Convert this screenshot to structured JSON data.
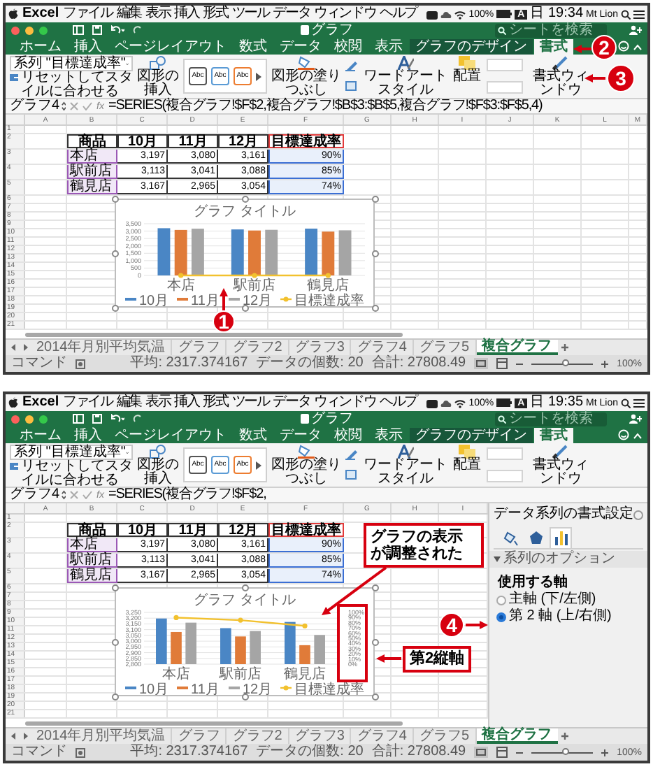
{
  "screens": [
    {
      "menu_bar": {
        "items": [
          "Excel",
          "ファイル",
          "編集",
          "表示",
          "挿入",
          "形式",
          "ツール",
          "データ",
          "ウィンドウ",
          "ヘルプ"
        ],
        "battery": "100%",
        "input_source": "A",
        "clock": "日 19:34",
        "user": "Mt Lion"
      },
      "title_bar": {
        "title": "グラフ",
        "search_placeholder": "シートを検索"
      },
      "ribbon_tabs": [
        {
          "label": "ホーム",
          "selected": false,
          "contextual": false
        },
        {
          "label": "挿入",
          "selected": false,
          "contextual": false
        },
        {
          "label": "ページレイアウト",
          "selected": false,
          "contextual": false
        },
        {
          "label": "数式",
          "selected": false,
          "contextual": false
        },
        {
          "label": "データ",
          "selected": false,
          "contextual": false
        },
        {
          "label": "校閲",
          "selected": false,
          "contextual": false
        },
        {
          "label": "表示",
          "selected": false,
          "contextual": false
        },
        {
          "label": "グラフのデザイン",
          "selected": false,
          "contextual": true
        },
        {
          "label": "書式",
          "selected": true,
          "contextual": true
        }
      ],
      "ribbon": {
        "series_selector": "系列 \"目標達成率\"",
        "reset_button": "リセットしてスタイルに合わせる",
        "insert_shape": "図形の挿入",
        "style_samples": [
          {
            "label": "Abc",
            "color": "#555555"
          },
          {
            "label": "Abc",
            "color": "#5b9bd5"
          },
          {
            "label": "Abc",
            "color": "#ed7d31"
          }
        ],
        "shape_fill": "図形の塗りつぶし",
        "wordart": "ワードアートスタイル",
        "arrange": "配置",
        "format_pane": "書式ウィンドウ"
      },
      "formula_bar": {
        "name_box": "グラフ4",
        "function_button": "fx",
        "formula": "=SERIES(複合グラフ!$F$2,複合グラフ!$B$3:$B$5,複合グラフ!$F$3:$F$5,4)"
      },
      "columns": [
        "A",
        "B",
        "C",
        "D",
        "E",
        "F",
        "G",
        "H",
        "I",
        "J",
        "K",
        "L",
        "M"
      ],
      "row_numbers": [
        "1",
        "2",
        "3",
        "4",
        "5",
        "6",
        "7",
        "8",
        "9",
        "10",
        "11",
        "12",
        "13",
        "14",
        "15",
        "16",
        "17",
        "18",
        "19",
        "20",
        "21"
      ],
      "table": {
        "header": [
          "商品",
          "10月",
          "11月",
          "12月",
          "目標達成率"
        ],
        "rows": [
          [
            "本店",
            "3,197",
            "3,080",
            "3,161",
            "90%"
          ],
          [
            "駅前店",
            "3,113",
            "3,041",
            "3,088",
            "85%"
          ],
          [
            "鶴見店",
            "3,167",
            "2,965",
            "3,054",
            "74%"
          ]
        ]
      },
      "chart": {
        "selected": true,
        "chart_data": {
          "type": "bar",
          "title": "グラフ タイトル",
          "categories": [
            "本店",
            "駅前店",
            "鶴見店"
          ],
          "series": [
            {
              "name": "10月",
              "color": "#4a86c5",
              "values": [
                3197,
                3113,
                3167
              ]
            },
            {
              "name": "11月",
              "color": "#e07b39",
              "values": [
                3080,
                3041,
                2965
              ]
            },
            {
              "name": "12月",
              "color": "#a5a5a5",
              "values": [
                3161,
                3088,
                3054
              ]
            },
            {
              "name": "目標達成率",
              "type": "line",
              "marker": "circle",
              "color": "#f2c12e",
              "values": [
                0.9,
                0.85,
                0.74
              ]
            }
          ],
          "ylim": [
            0,
            3500
          ],
          "yticks": [
            {
              "value": 0,
              "label": "0"
            },
            {
              "value": 500,
              "label": "500"
            },
            {
              "value": 1000,
              "label": "1,000"
            },
            {
              "value": 1500,
              "label": "1,500"
            },
            {
              "value": 2000,
              "label": "2,000"
            },
            {
              "value": 2500,
              "label": "2,500"
            },
            {
              "value": 3000,
              "label": "3,000"
            },
            {
              "value": 3500,
              "label": "3,500"
            }
          ],
          "grid": true,
          "legend": true
        }
      },
      "sheet_tabs": [
        {
          "label": "2014年月別平均気温",
          "selected": false
        },
        {
          "label": "グラフ",
          "selected": false
        },
        {
          "label": "グラフ2",
          "selected": false
        },
        {
          "label": "グラフ3",
          "selected": false
        },
        {
          "label": "グラフ4",
          "selected": false
        },
        {
          "label": "グラフ5",
          "selected": false
        },
        {
          "label": "複合グラフ",
          "selected": true
        }
      ],
      "status_bar": {
        "mode": "コマンド",
        "average": "平均: 2317.374167",
        "count": "データの個数: 20",
        "sum": "合計: 27808.49",
        "zoom": "100%",
        "zoom_slider": {
          "level": 0.55
        }
      },
      "callouts": [
        {
          "kind": "badge",
          "text": "2"
        },
        {
          "kind": "badge",
          "text": "3"
        },
        {
          "kind": "badge",
          "text": "1"
        }
      ]
    },
    {
      "menu_bar": {
        "items": [
          "Excel",
          "ファイル",
          "編集",
          "表示",
          "挿入",
          "形式",
          "ツール",
          "データ",
          "ウィンドウ",
          "ヘルプ"
        ],
        "battery": "100%",
        "input_source": "A",
        "clock": "日 19:35",
        "user": "Mt Lion"
      },
      "title_bar": {
        "title": "グラフ",
        "search_placeholder": "シートを検索"
      },
      "ribbon_tabs": [
        {
          "label": "ホーム",
          "selected": false,
          "contextual": false
        },
        {
          "label": "挿入",
          "selected": false,
          "contextual": false
        },
        {
          "label": "ページレイアウト",
          "selected": false,
          "contextual": false
        },
        {
          "label": "数式",
          "selected": false,
          "contextual": false
        },
        {
          "label": "データ",
          "selected": false,
          "contextual": false
        },
        {
          "label": "校閲",
          "selected": false,
          "contextual": false
        },
        {
          "label": "表示",
          "selected": false,
          "contextual": false
        },
        {
          "label": "グラフのデザイン",
          "selected": false,
          "contextual": true
        },
        {
          "label": "書式",
          "selected": true,
          "contextual": true
        }
      ],
      "ribbon": {
        "series_selector": "系列 \"目標達成率\"",
        "reset_button": "リセットしてスタイルに合わせる",
        "insert_shape": "図形の挿入",
        "style_samples": [
          {
            "label": "Abc",
            "color": "#555555"
          },
          {
            "label": "Abc",
            "color": "#5b9bd5"
          },
          {
            "label": "Abc",
            "color": "#ed7d31"
          }
        ],
        "shape_fill": "図形の塗りつぶし",
        "wordart": "ワードアートスタイル",
        "arrange": "配置",
        "format_pane": "書式ウィンドウ"
      },
      "formula_bar": {
        "name_box": "グラフ4",
        "function_button": "fx",
        "formula": "=SERIES(複合グラフ!$F$2,"
      },
      "columns": [
        "A",
        "B",
        "C",
        "D",
        "E",
        "F",
        "G",
        "H",
        "I"
      ],
      "row_numbers": [
        "1",
        "2",
        "3",
        "4",
        "5",
        "6",
        "7",
        "8",
        "9",
        "10",
        "11",
        "12",
        "13",
        "14",
        "15",
        "16",
        "17",
        "18",
        "19",
        "20",
        "21"
      ],
      "table": {
        "header": [
          "商品",
          "10月",
          "11月",
          "12月",
          "目標達成率"
        ],
        "rows": [
          [
            "本店",
            "3,197",
            "3,080",
            "3,161",
            "90%"
          ],
          [
            "駅前店",
            "3,113",
            "3,041",
            "3,088",
            "85%"
          ],
          [
            "鶴見店",
            "3,167",
            "2,965",
            "3,054",
            "74%"
          ]
        ]
      },
      "chart": {
        "selected": true,
        "chart_data": {
          "type": "bar",
          "title": "グラフ タイトル",
          "categories": [
            "本店",
            "駅前店",
            "鶴見店"
          ],
          "series": [
            {
              "name": "10月",
              "color": "#4a86c5",
              "values": [
                3197,
                3113,
                3167
              ]
            },
            {
              "name": "11月",
              "color": "#e07b39",
              "values": [
                3080,
                3041,
                2965
              ]
            },
            {
              "name": "12月",
              "color": "#a5a5a5",
              "values": [
                3161,
                3088,
                3054
              ]
            },
            {
              "name": "目標達成率",
              "type": "line",
              "axis": "y2",
              "marker": "circle",
              "color": "#f2c12e",
              "values": [
                0.9,
                0.85,
                0.74
              ]
            }
          ],
          "ylim": [
            2800,
            3250
          ],
          "yticks": [
            {
              "value": 2800,
              "label": "2,800"
            },
            {
              "value": 2850,
              "label": "2,850"
            },
            {
              "value": 2900,
              "label": "2,900"
            },
            {
              "value": 2950,
              "label": "2,950"
            },
            {
              "value": 3000,
              "label": "3,000"
            },
            {
              "value": 3050,
              "label": "3,050"
            },
            {
              "value": 3100,
              "label": "3,100"
            },
            {
              "value": 3150,
              "label": "3,150"
            },
            {
              "value": 3200,
              "label": "3,200"
            },
            {
              "value": 3250,
              "label": "3,250"
            }
          ],
          "y2lim": [
            0,
            1
          ],
          "y2ticks": [
            {
              "value": 0,
              "label": "0%"
            },
            {
              "value": 0.1,
              "label": "10%"
            },
            {
              "value": 0.2,
              "label": "20%"
            },
            {
              "value": 0.3,
              "label": "30%"
            },
            {
              "value": 0.4,
              "label": "40%"
            },
            {
              "value": 0.5,
              "label": "50%"
            },
            {
              "value": 0.6,
              "label": "60%"
            },
            {
              "value": 0.7,
              "label": "70%"
            },
            {
              "value": 0.8,
              "label": "80%"
            },
            {
              "value": 0.9,
              "label": "90%"
            },
            {
              "value": 1,
              "label": "100%"
            }
          ],
          "grid": true,
          "legend": true
        }
      },
      "format_pane": {
        "title": "データ系列の書式設定",
        "tabs": [
          {
            "kind": "fill",
            "selected": false
          },
          {
            "kind": "effects",
            "selected": false
          },
          {
            "kind": "options",
            "selected": true
          }
        ],
        "section": {
          "label": "系列のオプション",
          "expanded": true
        },
        "group_label": "使用する軸",
        "options": [
          {
            "label": "主軸 (下/左側)",
            "selected": false
          },
          {
            "label": "第 2 軸 (上/右側)",
            "selected": true
          }
        ]
      },
      "sheet_tabs": [
        {
          "label": "2014年月別平均気温",
          "selected": false
        },
        {
          "label": "グラフ",
          "selected": false
        },
        {
          "label": "グラフ2",
          "selected": false
        },
        {
          "label": "グラフ3",
          "selected": false
        },
        {
          "label": "グラフ4",
          "selected": false
        },
        {
          "label": "グラフ5",
          "selected": false
        },
        {
          "label": "複合グラフ",
          "selected": true
        }
      ],
      "status_bar": {
        "mode": "コマンド",
        "average": "平均: 2317.374167",
        "count": "データの個数: 20",
        "sum": "合計: 27808.49",
        "zoom": "100%",
        "zoom_slider": {
          "level": 0.55
        }
      },
      "callouts": [
        {
          "kind": "label",
          "text": "グラフの表示が調整された"
        },
        {
          "kind": "badge",
          "text": "4"
        },
        {
          "kind": "label",
          "text": "第2縦軸"
        },
        {
          "kind": "frame"
        }
      ]
    }
  ]
}
